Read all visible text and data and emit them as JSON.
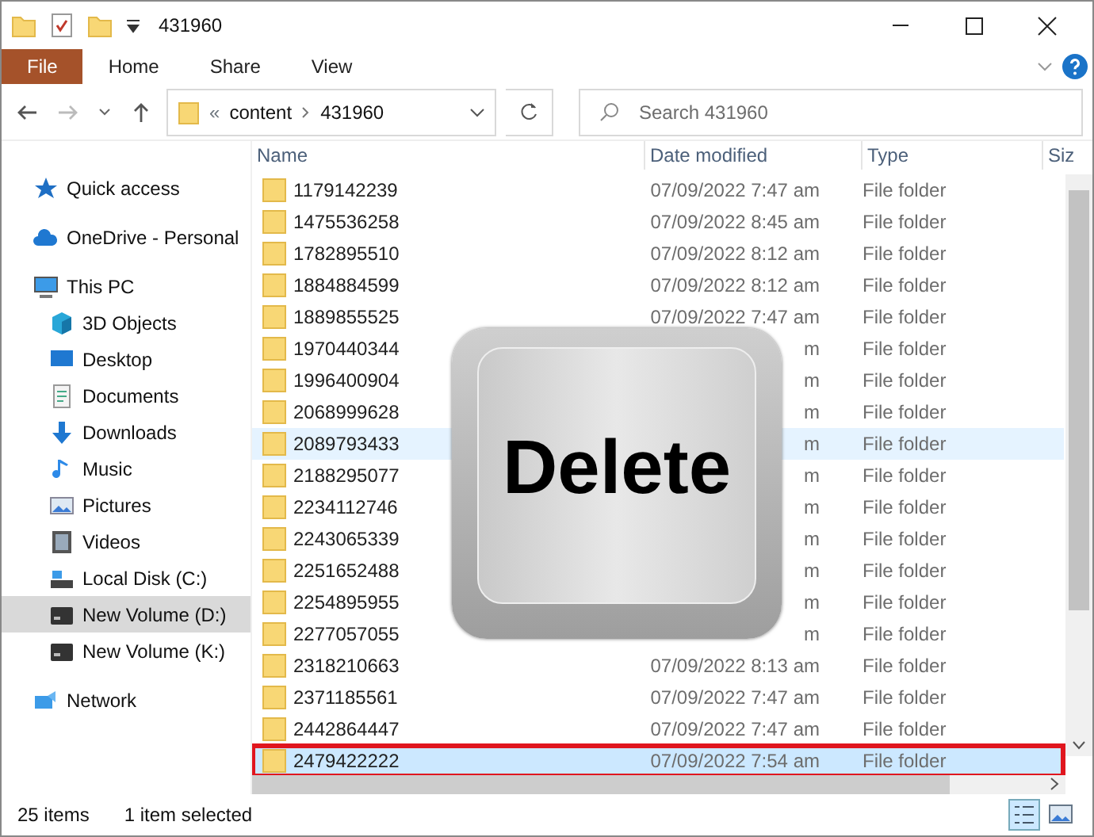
{
  "window": {
    "title": "431960"
  },
  "ribbon": {
    "tabs": [
      {
        "label": "File",
        "selected": true
      },
      {
        "label": "Home",
        "selected": false
      },
      {
        "label": "Share",
        "selected": false
      },
      {
        "label": "View",
        "selected": false
      }
    ]
  },
  "address": {
    "overflow": "«",
    "path": [
      "content",
      "431960"
    ],
    "search_placeholder": "Search 431960"
  },
  "sidebar": [
    {
      "label": "Quick access",
      "selected": false
    },
    {
      "label": "OneDrive - Personal",
      "selected": false
    },
    {
      "label": "This PC",
      "selected": false,
      "children": [
        {
          "label": "3D Objects",
          "selected": false
        },
        {
          "label": "Desktop",
          "selected": false
        },
        {
          "label": "Documents",
          "selected": false
        },
        {
          "label": "Downloads",
          "selected": false
        },
        {
          "label": "Music",
          "selected": false
        },
        {
          "label": "Pictures",
          "selected": false
        },
        {
          "label": "Videos",
          "selected": false
        },
        {
          "label": "Local Disk (C:)",
          "selected": false
        },
        {
          "label": "New Volume (D:)",
          "selected": true
        },
        {
          "label": "New Volume (K:)",
          "selected": false
        }
      ]
    },
    {
      "label": "Network",
      "selected": false
    }
  ],
  "table": {
    "columns": [
      "Name",
      "Date modified",
      "Type",
      "Siz"
    ],
    "rows": [
      {
        "name": "1179142239",
        "date": "07/09/2022 7:47 am",
        "type": "File folder",
        "selected": false,
        "hot": false,
        "outlined": false
      },
      {
        "name": "1475536258",
        "date": "07/09/2022 8:45 am",
        "type": "File folder",
        "selected": false,
        "hot": false,
        "outlined": false
      },
      {
        "name": "1782895510",
        "date": "07/09/2022 8:12 am",
        "type": "File folder",
        "selected": false,
        "hot": false,
        "outlined": false
      },
      {
        "name": "1884884599",
        "date": "07/09/2022 8:12 am",
        "type": "File folder",
        "selected": false,
        "hot": false,
        "outlined": false
      },
      {
        "name": "1889855525",
        "date": "07/09/2022 7:47 am",
        "type": "File folder",
        "selected": false,
        "hot": false,
        "outlined": false
      },
      {
        "name": "1970440344",
        "date": "m",
        "type": "File folder",
        "selected": false,
        "hot": false,
        "outlined": false
      },
      {
        "name": "1996400904",
        "date": "m",
        "type": "File folder",
        "selected": false,
        "hot": false,
        "outlined": false
      },
      {
        "name": "2068999628",
        "date": "m",
        "type": "File folder",
        "selected": false,
        "hot": false,
        "outlined": false
      },
      {
        "name": "2089793433",
        "date": "m",
        "type": "File folder",
        "selected": false,
        "hot": true,
        "outlined": false
      },
      {
        "name": "2188295077",
        "date": "m",
        "type": "File folder",
        "selected": false,
        "hot": false,
        "outlined": false
      },
      {
        "name": "2234112746",
        "date": "m",
        "type": "File folder",
        "selected": false,
        "hot": false,
        "outlined": false
      },
      {
        "name": "2243065339",
        "date": "m",
        "type": "File folder",
        "selected": false,
        "hot": false,
        "outlined": false
      },
      {
        "name": "2251652488",
        "date": "m",
        "type": "File folder",
        "selected": false,
        "hot": false,
        "outlined": false
      },
      {
        "name": "2254895955",
        "date": "m",
        "type": "File folder",
        "selected": false,
        "hot": false,
        "outlined": false
      },
      {
        "name": "2277057055",
        "date": "m",
        "type": "File folder",
        "selected": false,
        "hot": false,
        "outlined": false
      },
      {
        "name": "2318210663",
        "date": "07/09/2022 8:13 am",
        "type": "File folder",
        "selected": false,
        "hot": false,
        "outlined": false
      },
      {
        "name": "2371185561",
        "date": "07/09/2022 7:47 am",
        "type": "File folder",
        "selected": false,
        "hot": false,
        "outlined": false
      },
      {
        "name": "2442864447",
        "date": "07/09/2022 7:47 am",
        "type": "File folder",
        "selected": false,
        "hot": false,
        "outlined": false
      },
      {
        "name": "2479422222",
        "date": "07/09/2022 7:54 am",
        "type": "File folder",
        "selected": true,
        "hot": false,
        "outlined": true
      }
    ]
  },
  "overlay": {
    "key_label": "Delete"
  },
  "status_bar": {
    "count": "25 items",
    "selection": "1 item selected"
  }
}
